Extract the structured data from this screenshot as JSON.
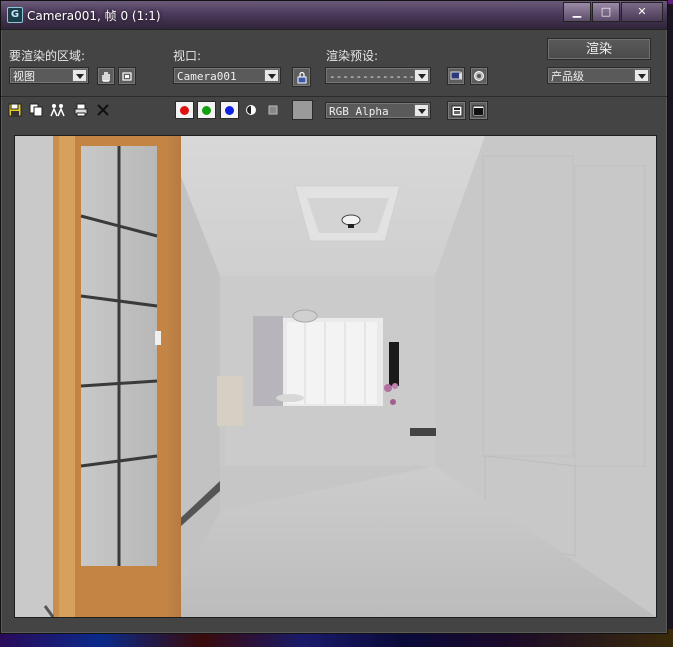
{
  "window": {
    "title": "Camera001, 帧 0 (1:1)",
    "app_icon_glyph": "G",
    "minimize_glyph": "▁",
    "maximize_glyph": "□",
    "close_glyph": "✕"
  },
  "toolbar": {
    "area_label": "要渲染的区域:",
    "area_value": "视图",
    "viewport_label": "视口:",
    "viewport_value": "Camera001",
    "preset_label": "渲染预设:",
    "preset_value": "---------------",
    "render_button": "渲染",
    "quality_value": "产品级",
    "channel_value": "RGB Alpha"
  },
  "icons": {
    "area": [
      "hand-icon",
      "region-icon"
    ],
    "viewport_lock": "lock-viewport-icon",
    "preset": [
      "render-setup-icon",
      "environment-icon"
    ],
    "file_tools": [
      "save-image-icon",
      "copy-image-icon",
      "clone-window-icon",
      "print-icon",
      "clear-icon"
    ],
    "display": [
      "toggle-ui-icon",
      "toggle-display-icon"
    ]
  },
  "colors": {
    "red_channel": "#e01010",
    "green_channel": "#10a010",
    "blue_channel": "#1020e0",
    "swatch": "#9a9a9a",
    "titlebar": "#4c3a5c"
  }
}
